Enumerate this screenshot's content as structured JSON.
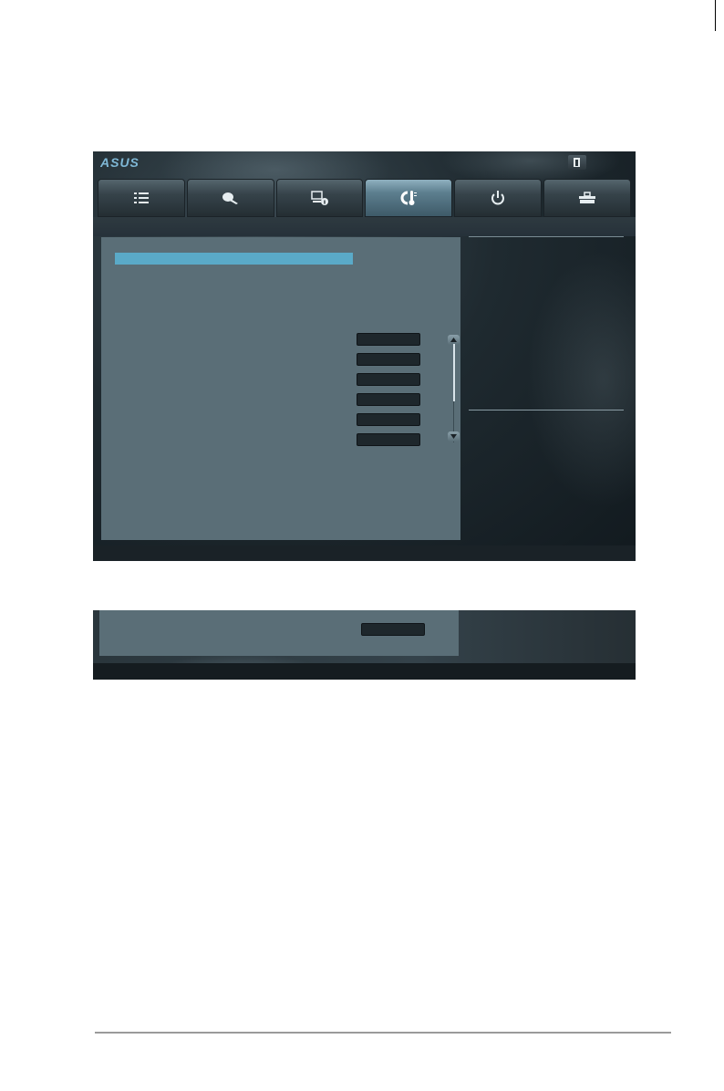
{
  "window": {
    "logo_text": "ASUS",
    "exit_icon": "exit-door-icon"
  },
  "tabs": [
    {
      "icon": "list-icon",
      "active": false
    },
    {
      "icon": "tweaker-icon",
      "active": false
    },
    {
      "icon": "system-info-icon",
      "active": false
    },
    {
      "icon": "monitor-thermometer-icon",
      "active": true
    },
    {
      "icon": "power-icon",
      "active": false
    },
    {
      "icon": "tool-icon",
      "active": false
    }
  ],
  "colors": {
    "accent": "#5aaac8",
    "panel": "#5a6e77",
    "value_box": "#1e272c"
  },
  "value_fields": [
    "",
    "",
    "",
    "",
    "",
    ""
  ],
  "secondary_value_field": ""
}
